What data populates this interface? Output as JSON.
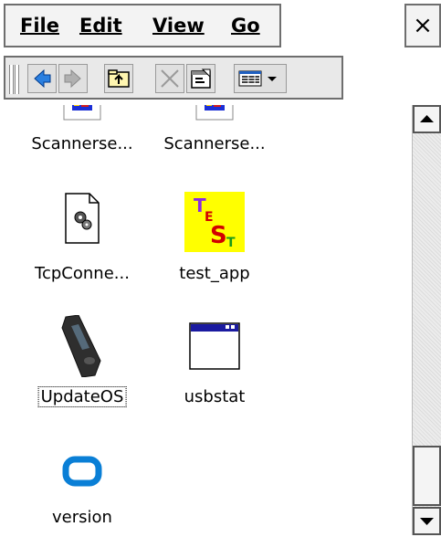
{
  "menu": {
    "file_label": "File",
    "edit_label": "Edit",
    "view_label": "View",
    "go_label": "Go",
    "close_label": "×"
  },
  "toolbar": {
    "buttons": [
      "back",
      "forward",
      "up-folder",
      "delete",
      "properties",
      "view-menu"
    ]
  },
  "files": [
    {
      "name": "Scannerse...",
      "icon": "app-icon-partial"
    },
    {
      "name": "Scannerse...",
      "icon": "app-icon-partial"
    },
    {
      "name": "TcpConne...",
      "icon": "settings-document-icon"
    },
    {
      "name": "test_app",
      "icon": "test-app-icon"
    },
    {
      "name": "UpdateOS",
      "icon": "handheld-device-icon"
    },
    {
      "name": "usbstat",
      "icon": "window-app-icon"
    },
    {
      "name": "version",
      "icon": "blue-rounded-square-icon"
    }
  ],
  "colors": {
    "accent": "#0a7fd6",
    "test_bg": "#ffff00",
    "border": "#6e6e6e"
  }
}
